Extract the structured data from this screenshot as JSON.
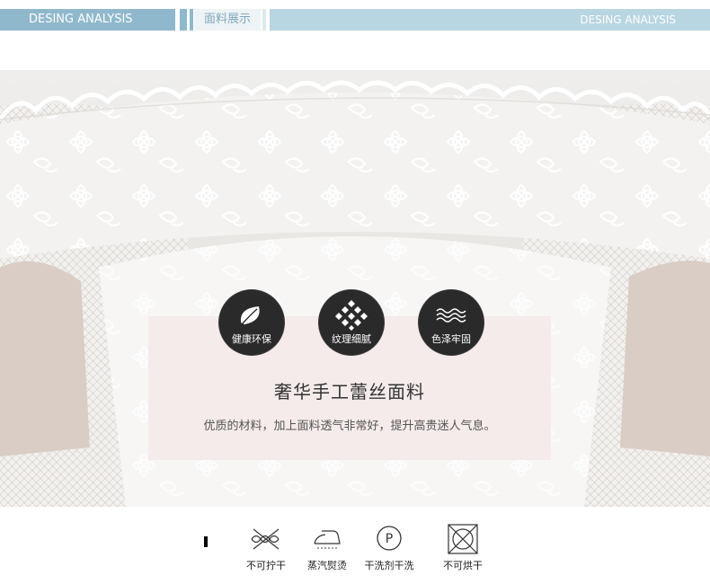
{
  "header": {
    "left_title": "DESING ANALYSIS",
    "section_title": "面料展示",
    "right_title": "DESING ANALYSIS"
  },
  "features": [
    {
      "label": "健康环保",
      "icon": "leaf-icon"
    },
    {
      "label": "纹理细腻",
      "icon": "diamond-grid-icon"
    },
    {
      "label": "色泽牢固",
      "icon": "wave-icon"
    }
  ],
  "card": {
    "title": "奢华手工蕾丝面料",
    "description": "优质的材料，加上面料透气非常好，提升高贵迷人气息。"
  },
  "care": [
    {
      "label": "不可拧干",
      "icon": "no-wring-icon"
    },
    {
      "label": "蒸汽熨烫",
      "icon": "steam-iron-icon"
    },
    {
      "label": "干洗剂干洗",
      "icon": "dry-clean-p-icon"
    },
    {
      "label": "不可烘干",
      "icon": "no-tumble-dry-icon"
    }
  ],
  "colors": {
    "header_blue": "#8fb8cc",
    "header_light": "#b8d5e2",
    "badge_dark": "#2b2a2a",
    "card_pink": "#f4e9e8"
  }
}
